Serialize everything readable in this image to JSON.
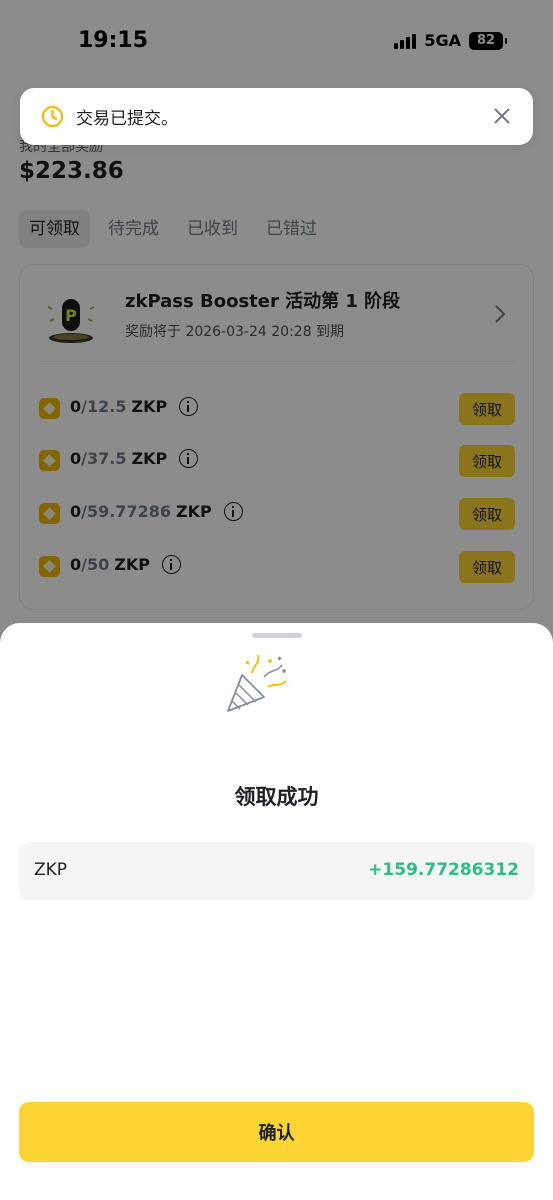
{
  "status_bar": {
    "time": "19:15",
    "network": "5GA",
    "battery": "82"
  },
  "header": {
    "subtitle": "我的全部奖励",
    "total": "$223.86"
  },
  "tabs": [
    {
      "label": "可领取",
      "active": true
    },
    {
      "label": "待完成",
      "active": false
    },
    {
      "label": "已收到",
      "active": false
    },
    {
      "label": "已错过",
      "active": false
    }
  ],
  "campaign": {
    "title": "zkPass Booster 活动第 1 阶段",
    "expiry": "奖励将于 2026-03-24 20:28 到期",
    "rewards": [
      {
        "claimed": "0",
        "separator": " / ",
        "target": "12.5",
        "unit": "ZKP",
        "button": "领取"
      },
      {
        "claimed": "0",
        "separator": " / ",
        "target": "37.5",
        "unit": "ZKP",
        "button": "领取"
      },
      {
        "claimed": "0",
        "separator": " / ",
        "target": "59.77286",
        "unit": "ZKP",
        "button": "领取"
      },
      {
        "claimed": "0",
        "separator": " / ",
        "target": "50",
        "unit": "ZKP",
        "button": "领取"
      }
    ]
  },
  "toast": {
    "message": "交易已提交。"
  },
  "sheet": {
    "title": "领取成功",
    "token": "ZKP",
    "amount": "+159.77286312",
    "confirm_label": "确认"
  },
  "colors": {
    "accent": "#fcd535",
    "success": "#2ebd85",
    "toast_icon": "#f0b90b"
  }
}
